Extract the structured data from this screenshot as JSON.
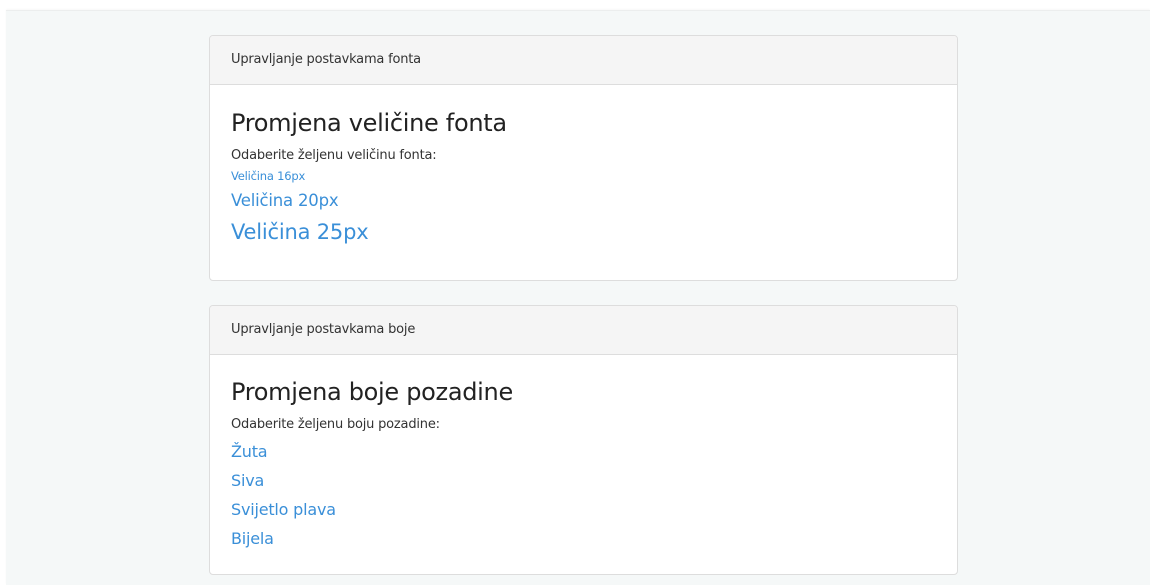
{
  "font_panel": {
    "heading": "Upravljanje postavkama fonta",
    "title": "Promjena veličine fonta",
    "prompt": "Odaberite željenu veličinu fonta:",
    "options": [
      {
        "label": "Veličina 16px"
      },
      {
        "label": "Veličina 20px"
      },
      {
        "label": "Veličina 25px"
      }
    ]
  },
  "color_panel": {
    "heading": "Upravljanje postavkama boje",
    "title": "Promjena boje pozadine",
    "prompt": "Odaberite željenu boju pozadine:",
    "options": [
      {
        "label": "Žuta"
      },
      {
        "label": "Siva"
      },
      {
        "label": "Svijetlo plava"
      },
      {
        "label": "Bijela"
      }
    ]
  },
  "colors": {
    "link": "#3a8fd8",
    "page_background": "#f5f8f8",
    "panel_heading_background": "#f5f5f5"
  }
}
